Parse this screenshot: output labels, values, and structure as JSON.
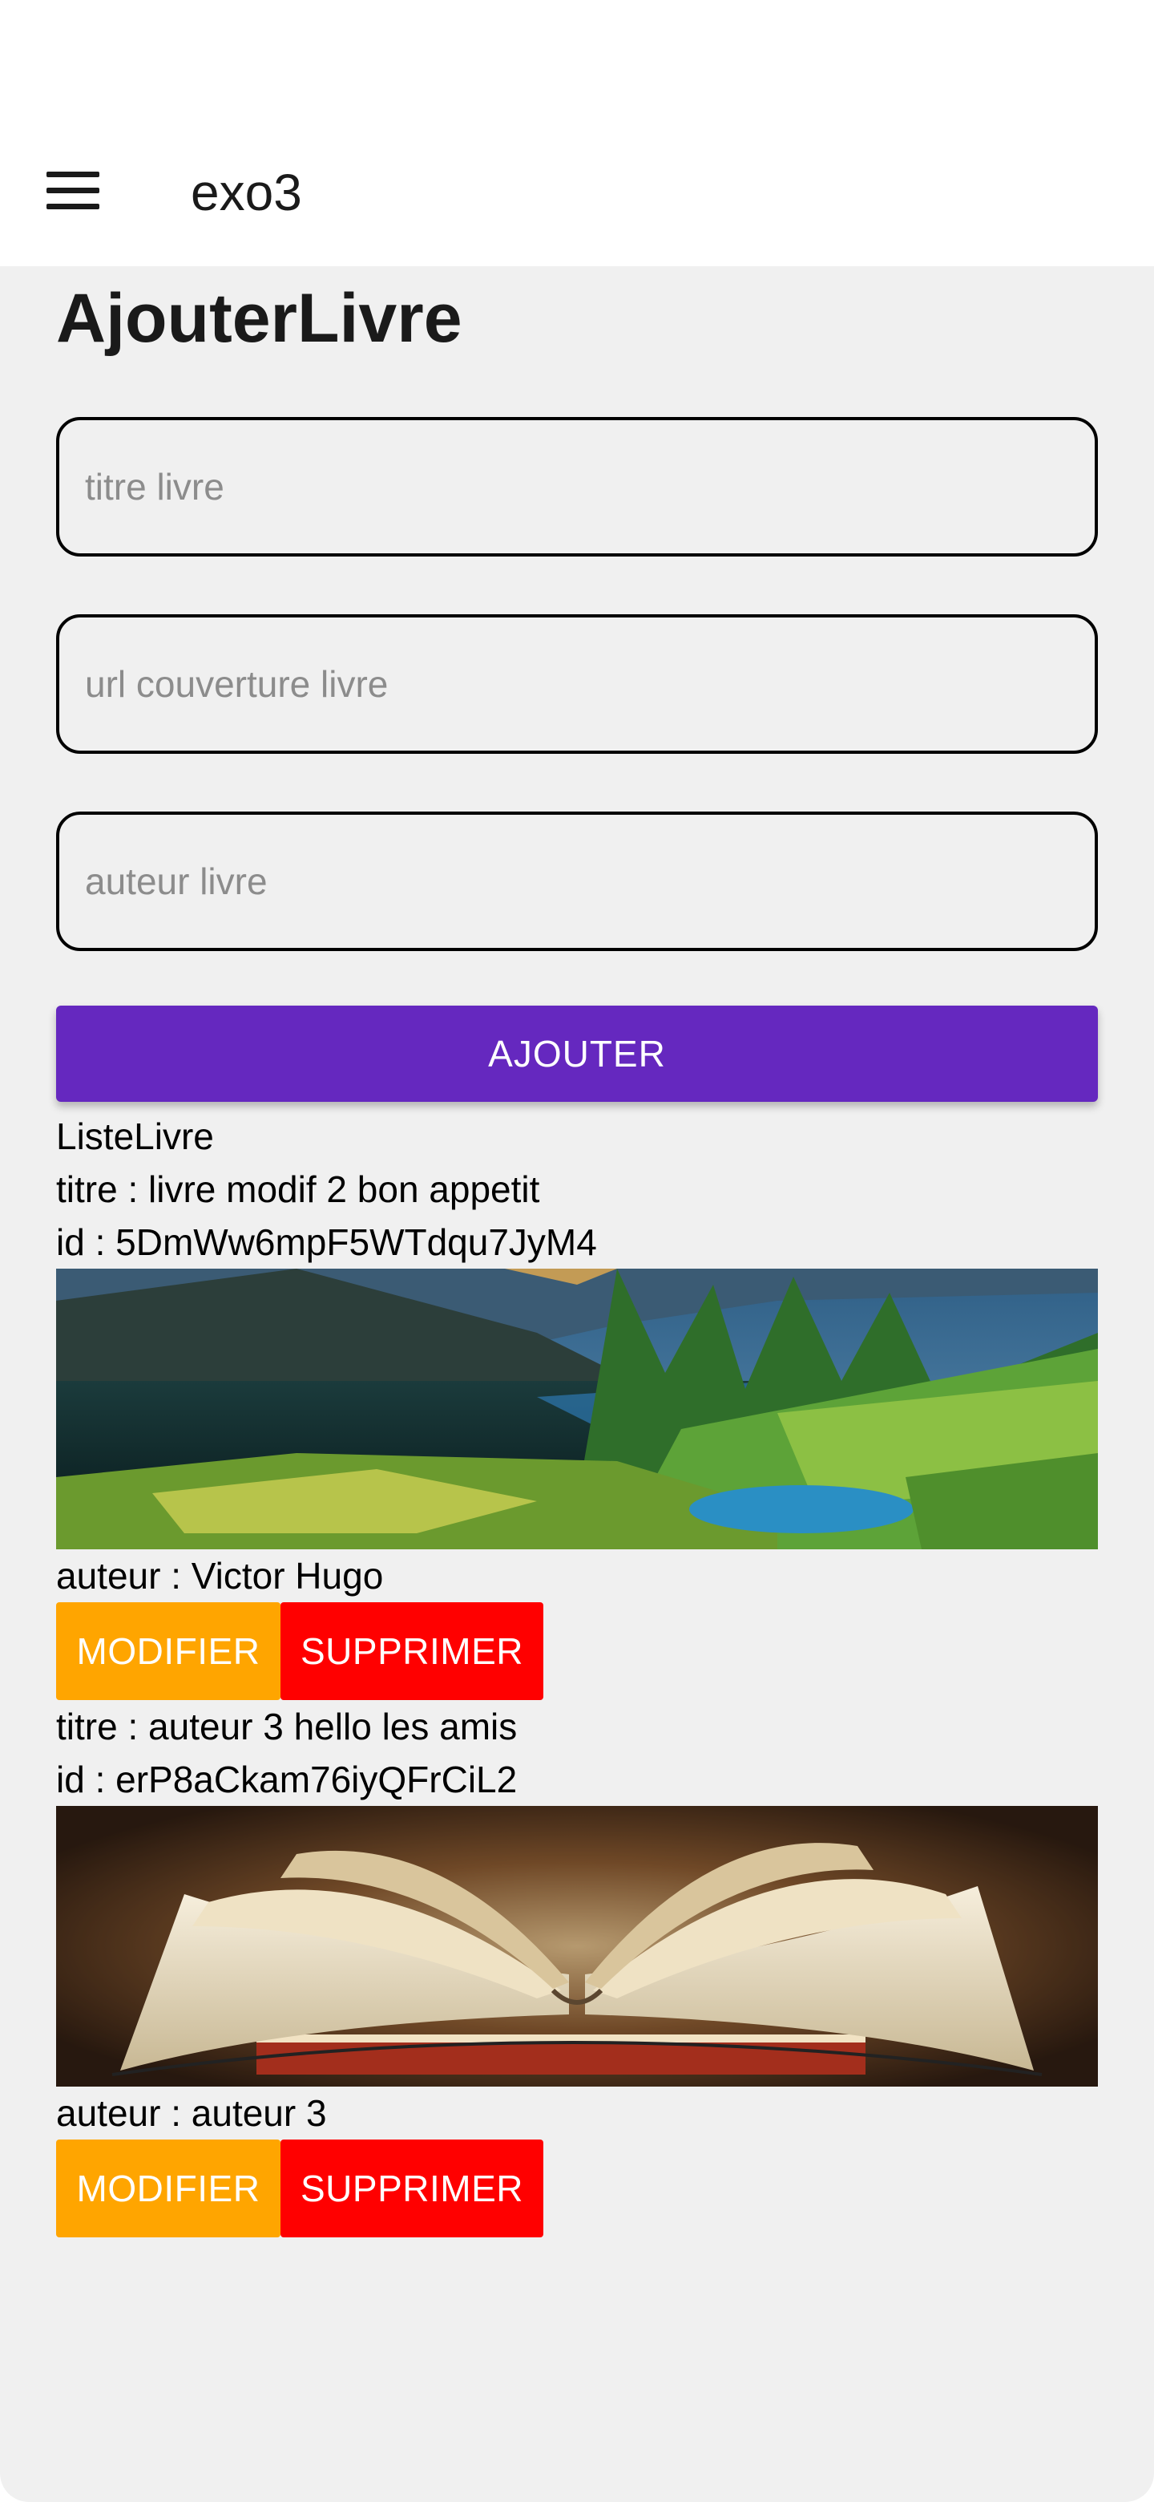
{
  "app_bar": {
    "title": "exo3",
    "menu_icon": "hamburger-menu-icon"
  },
  "form": {
    "heading": "AjouterLivre",
    "title_placeholder": "titre livre",
    "cover_url_placeholder": "url couverture livre",
    "author_placeholder": "auteur livre",
    "submit_label": "AJOUTER"
  },
  "list": {
    "heading": "ListeLivre",
    "books": [
      {
        "title_line": "titre : livre modif 2 bon appetit",
        "id_line": "id : 5DmWw6mpF5WTdqu7JyM4",
        "cover": "mountain-lake-landscape-image",
        "author_line": "auteur : Victor Hugo",
        "modify_label": "MODIFIER",
        "delete_label": "SUPPRIMER"
      },
      {
        "title_line": "titre : auteur 3 hello les amis",
        "id_line": "id : erP8aCkam76iyQFrCiL2",
        "cover": "open-book-image",
        "author_line": "auteur : auteur 3",
        "modify_label": "MODIFIER",
        "delete_label": "SUPPRIMER"
      }
    ]
  },
  "colors": {
    "primary": "#6528bf",
    "modify": "#ffa500",
    "delete": "#ff0000",
    "background": "#f0f0f0"
  }
}
